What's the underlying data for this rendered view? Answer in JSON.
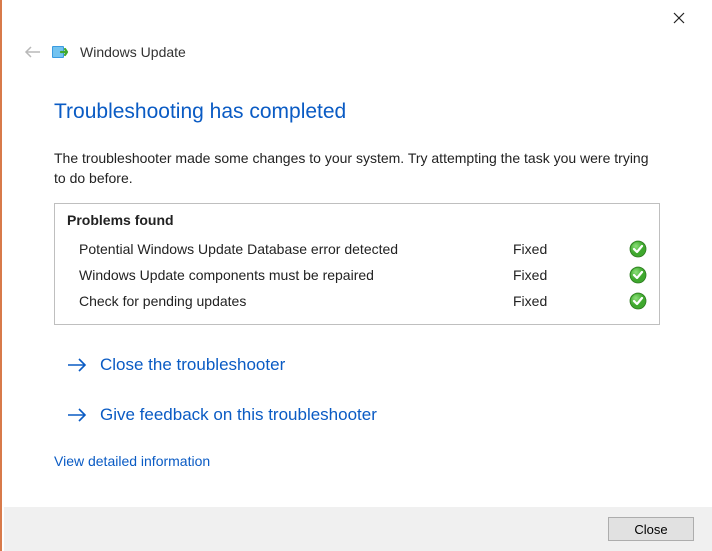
{
  "window": {
    "app_title": "Windows Update"
  },
  "page": {
    "heading": "Troubleshooting has completed",
    "description": "The troubleshooter made some changes to your system. Try attempting the task you were trying to do before.",
    "problems_header": "Problems found",
    "problems": [
      {
        "label": "Potential Windows Update Database error detected",
        "status": "Fixed"
      },
      {
        "label": "Windows Update components must be repaired",
        "status": "Fixed"
      },
      {
        "label": "Check for pending updates",
        "status": "Fixed"
      }
    ],
    "actions": {
      "close_troubleshooter": "Close the troubleshooter",
      "give_feedback": "Give feedback on this troubleshooter"
    },
    "detailed_link": "View detailed information"
  },
  "footer": {
    "close_label": "Close"
  },
  "colors": {
    "accent": "#0a5bc4",
    "success": "#3fa82e"
  }
}
